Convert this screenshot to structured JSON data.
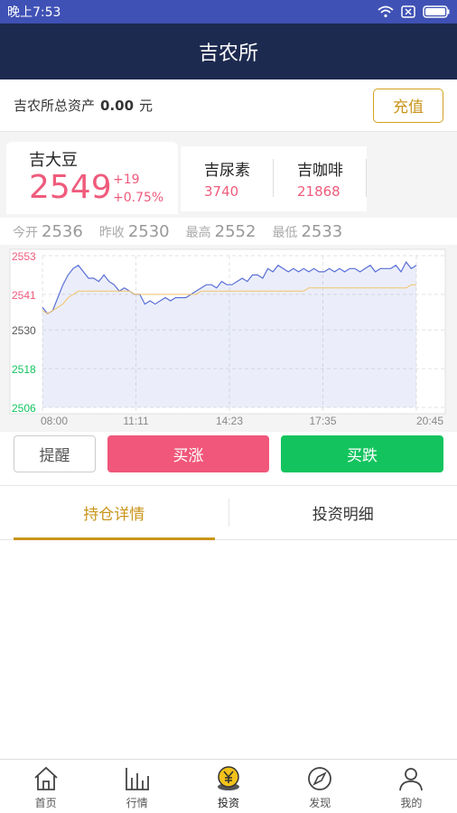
{
  "status_bar": {
    "time": "晚上7:53"
  },
  "header": {
    "title": "吉农所"
  },
  "asset": {
    "label": "吉农所总资产",
    "value": "0.00",
    "unit": "元",
    "recharge_label": "充值"
  },
  "quotes": {
    "main": {
      "name": "吉大豆",
      "price": "2549",
      "change": "+19",
      "change_pct": "+0.75%"
    },
    "others": [
      {
        "name": "吉尿素",
        "price": "3740"
      },
      {
        "name": "吉咖啡",
        "price": "21868"
      }
    ]
  },
  "stats": [
    {
      "label": "今开",
      "value": "2536"
    },
    {
      "label": "昨收",
      "value": "2530"
    },
    {
      "label": "最高",
      "value": "2552"
    },
    {
      "label": "最低",
      "value": "2533"
    }
  ],
  "colors": {
    "up": "#f0577a",
    "down": "#13c45e",
    "accent": "#c9951a",
    "header_bg": "#1d2a4f",
    "status_bg": "#3f51b5"
  },
  "chart_data": {
    "type": "line",
    "x_ticks": [
      "08:00",
      "11:11",
      "14:23",
      "17:35",
      "20:45"
    ],
    "y_ticks": [
      2553,
      2541,
      2530,
      2518,
      2506
    ],
    "ylim": [
      2506,
      2553
    ],
    "series": [
      {
        "values": [
          2537,
          2535,
          2536,
          2540,
          2544,
          2547,
          2549,
          2550,
          2548,
          2546,
          2546,
          2545,
          2547,
          2545,
          2544,
          2542,
          2543,
          2542,
          2541,
          2541,
          2538,
          2539,
          2538,
          2539,
          2540,
          2539,
          2540,
          2540,
          2540,
          2541,
          2542,
          2543,
          2544,
          2544,
          2543,
          2545,
          2544,
          2544,
          2545,
          2546,
          2545,
          2547,
          2547,
          2546,
          2549,
          2548,
          2550,
          2549,
          2548,
          2549,
          2548,
          2549,
          2548,
          2549,
          2548,
          2548,
          2549,
          2548,
          2549,
          2548,
          2549,
          2549,
          2548,
          2549,
          2550,
          2548,
          2549,
          2549,
          2549,
          2550,
          2548,
          2551,
          2549,
          2550
        ]
      },
      {
        "values": [
          2536,
          2535,
          2536,
          2537,
          2538,
          2540,
          2541,
          2542,
          2542,
          2542,
          2542,
          2542,
          2542,
          2542,
          2542,
          2542,
          2542,
          2542,
          2541,
          2541,
          2541,
          2541,
          2541,
          2541,
          2541,
          2541,
          2541,
          2541,
          2541,
          2541,
          2541,
          2542,
          2542,
          2542,
          2542,
          2542,
          2542,
          2542,
          2542,
          2542,
          2542,
          2542,
          2542,
          2542,
          2542,
          2542,
          2542,
          2542,
          2542,
          2542,
          2542,
          2542,
          2543,
          2543,
          2543,
          2543,
          2543,
          2543,
          2543,
          2543,
          2543,
          2543,
          2543,
          2543,
          2543,
          2543,
          2543,
          2543,
          2543,
          2543,
          2543,
          2543,
          2544,
          2544
        ]
      }
    ],
    "series_colors": [
      "#5a6fd6",
      "#f2c46a"
    ],
    "grid": true
  },
  "actions": {
    "remind": "提醒",
    "buy_up": "买涨",
    "buy_down": "买跌"
  },
  "tabs": [
    {
      "label": "持仓详情"
    },
    {
      "label": "投资明细"
    }
  ],
  "nav": [
    {
      "label": "首页",
      "icon": "home-icon"
    },
    {
      "label": "行情",
      "icon": "chart-icon"
    },
    {
      "label": "投资",
      "icon": "yen-coin-icon"
    },
    {
      "label": "发现",
      "icon": "compass-icon"
    },
    {
      "label": "我的",
      "icon": "user-icon"
    }
  ]
}
